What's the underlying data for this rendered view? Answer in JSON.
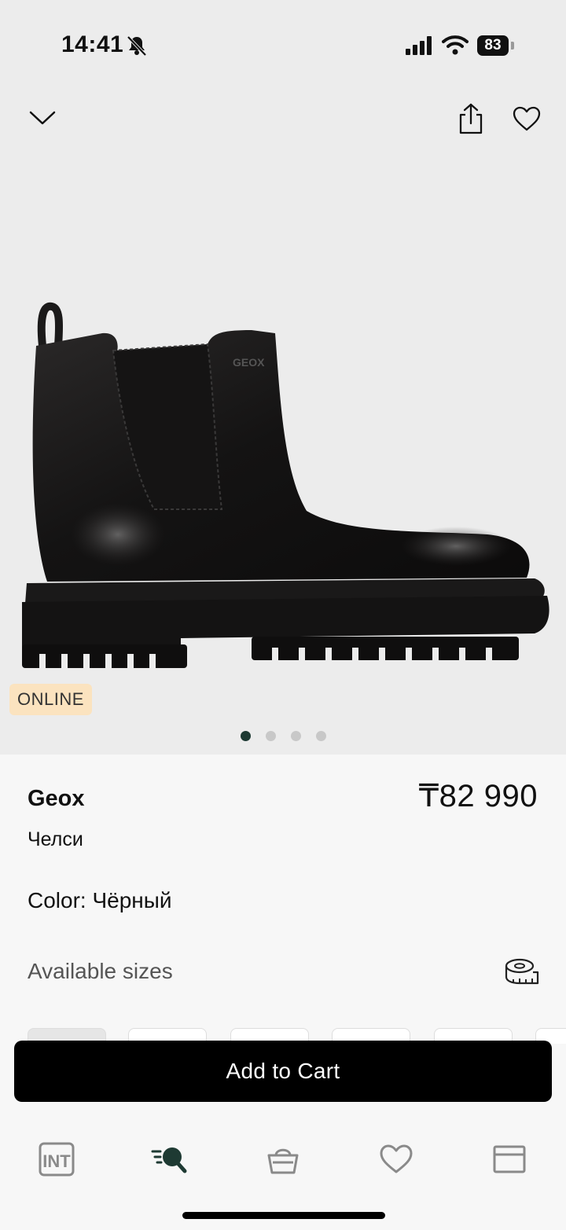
{
  "status_bar": {
    "time": "14:41",
    "battery": "83"
  },
  "header": {
    "icons": [
      "chevron-down-icon",
      "share-icon",
      "heart-icon"
    ]
  },
  "gallery": {
    "badge": "ONLINE",
    "logo_text": "GEOX",
    "page_count": 4,
    "active_page": 1
  },
  "product": {
    "brand": "Geox",
    "price": "₸82 990",
    "model": "Челси",
    "color": "Color: Чёрный",
    "sizes_label": "Available sizes"
  },
  "actions": {
    "add_to_cart": "Add to Cart"
  },
  "tabbar": {
    "items": [
      "home-logo-icon",
      "search-icon",
      "basket-icon",
      "favorites-icon",
      "catalog-icon"
    ],
    "logo_text": "INT"
  },
  "colors": {
    "accent": "#1e3a33",
    "badge_bg": "#fbe3bf",
    "button_bg": "#000000"
  }
}
